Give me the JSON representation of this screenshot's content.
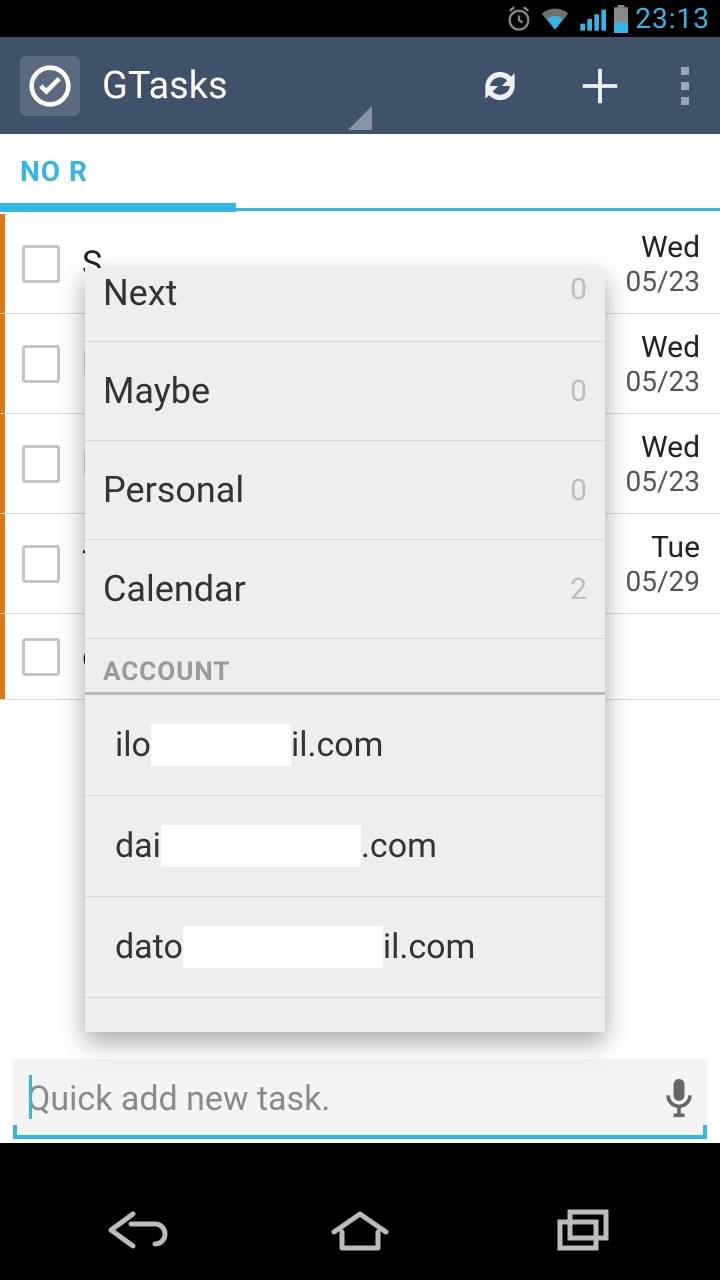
{
  "status": {
    "time": "23:13"
  },
  "header": {
    "title": "GTasks"
  },
  "tabs": {
    "visible_label": "NO R"
  },
  "tasks": [
    {
      "title_first_char": "S",
      "dow": "Wed",
      "date": "05/23",
      "accent": true
    },
    {
      "title_first_char": "M",
      "dow": "Wed",
      "date": "05/23",
      "accent": true
    },
    {
      "title_first_char": "M",
      "dow": "Wed",
      "date": "05/23",
      "accent": true
    },
    {
      "title_first_char": "T",
      "dow": "Tue",
      "date": "05/29",
      "accent": true
    },
    {
      "title_first_char": "q",
      "dow": "",
      "date": "",
      "accent": true
    }
  ],
  "dropdown": {
    "lists": [
      {
        "label": "Next",
        "count": "0"
      },
      {
        "label": "Maybe",
        "count": "0"
      },
      {
        "label": "Personal",
        "count": "0"
      },
      {
        "label": "Calendar",
        "count": "2"
      }
    ],
    "section_header": "ACCOUNT",
    "accounts": [
      {
        "prefix": "ilo",
        "mask_w": 140,
        "suffix": "il.com"
      },
      {
        "prefix": "dai",
        "mask_w": 200,
        "suffix": ".com"
      },
      {
        "prefix": "dato",
        "mask_w": 200,
        "suffix": "il.com"
      }
    ]
  },
  "quick_add": {
    "placeholder": "Quick add new task."
  }
}
